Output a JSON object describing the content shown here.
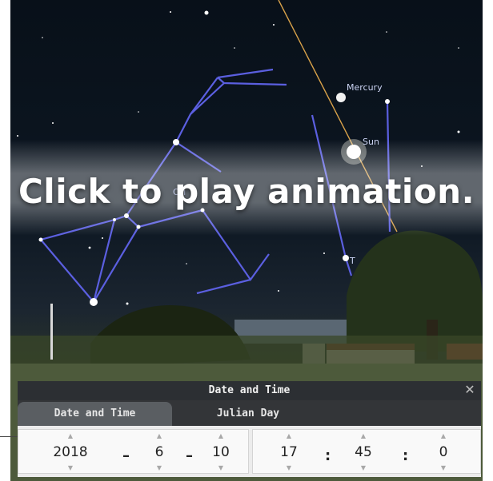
{
  "overlay": {
    "text": "Click to play animation."
  },
  "sky_labels": {
    "mercury": "Mercury",
    "sun": "Sun",
    "orion": "Ori",
    "t_label": "T"
  },
  "dialog": {
    "title": "Date and Time",
    "close_label": "✕",
    "tabs": [
      {
        "label": "Date and Time",
        "active": true
      },
      {
        "label": "Julian Day",
        "active": false
      }
    ],
    "date": {
      "year": "2018",
      "month": "6",
      "day": "10",
      "sep1": "–",
      "sep2": "–"
    },
    "time": {
      "hour": "17",
      "minute": "45",
      "second": "0",
      "sep1": ":",
      "sep2": ":"
    },
    "spin_up": "▲",
    "spin_down": "▼"
  },
  "colors": {
    "constellation_line": "#5b5fe0",
    "ecliptic": "#d9a24a",
    "panel_bg": "#ececec",
    "title_bar": "#2c2f33"
  }
}
